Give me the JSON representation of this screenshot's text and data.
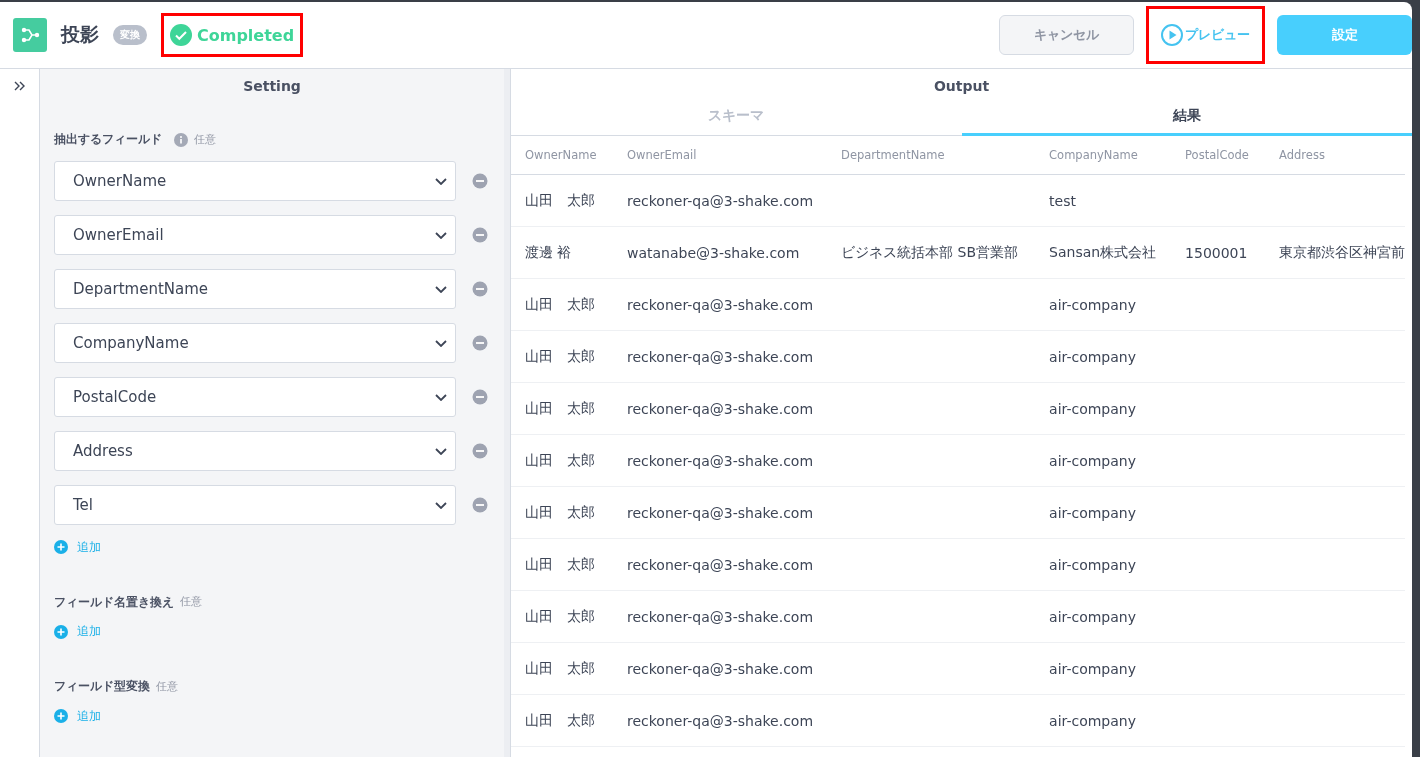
{
  "header": {
    "title": "投影",
    "tag": "変換",
    "status": {
      "label": "Completed",
      "highlighted": true
    },
    "buttons": [
      {
        "label": "キャンセル",
        "kind": "secondary",
        "highlighted": false
      },
      {
        "label": "プレビュー",
        "kind": "preview",
        "highlighted": true
      },
      {
        "label": "設定",
        "kind": "primary",
        "highlighted": false
      }
    ]
  },
  "setting": {
    "title": "Setting",
    "sections": [
      {
        "label": "抽出するフィールド",
        "info": true,
        "optional": "任意",
        "fields": [
          "OwnerName",
          "OwnerEmail",
          "DepartmentName",
          "CompanyName",
          "PostalCode",
          "Address",
          "Tel"
        ],
        "add": "追加"
      },
      {
        "label": "フィールド名置き換え",
        "info": false,
        "optional": "任意",
        "add": "追加"
      },
      {
        "label": "フィールド型変換",
        "info": false,
        "optional": "任意",
        "add": "追加"
      }
    ]
  },
  "output": {
    "title": "Output",
    "tabs": [
      {
        "label": "スキーマ",
        "selected": false
      },
      {
        "label": "結果",
        "selected": true
      }
    ],
    "table": {
      "columns": [
        "OwnerName",
        "OwnerEmail",
        "DepartmentName",
        "CompanyName",
        "PostalCode",
        "Address"
      ],
      "rows": [
        [
          "山田　太郎",
          "reckoner-qa@3-shake.com",
          "",
          "test",
          "",
          ""
        ],
        [
          "渡邊 裕",
          "watanabe@3-shake.com",
          "ビジネス統括本部 SB営業部",
          "Sansan株式会社",
          "1500001",
          "東京都渋谷区神宮前"
        ],
        [
          "山田　太郎",
          "reckoner-qa@3-shake.com",
          "",
          "air-company",
          "",
          ""
        ],
        [
          "山田　太郎",
          "reckoner-qa@3-shake.com",
          "",
          "air-company",
          "",
          ""
        ],
        [
          "山田　太郎",
          "reckoner-qa@3-shake.com",
          "",
          "air-company",
          "",
          ""
        ],
        [
          "山田　太郎",
          "reckoner-qa@3-shake.com",
          "",
          "air-company",
          "",
          ""
        ],
        [
          "山田　太郎",
          "reckoner-qa@3-shake.com",
          "",
          "air-company",
          "",
          ""
        ],
        [
          "山田　太郎",
          "reckoner-qa@3-shake.com",
          "",
          "air-company",
          "",
          ""
        ],
        [
          "山田　太郎",
          "reckoner-qa@3-shake.com",
          "",
          "air-company",
          "",
          ""
        ],
        [
          "山田　太郎",
          "reckoner-qa@3-shake.com",
          "",
          "air-company",
          "",
          ""
        ],
        [
          "山田　太郎",
          "reckoner-qa@3-shake.com",
          "",
          "air-company",
          "",
          ""
        ]
      ]
    }
  }
}
